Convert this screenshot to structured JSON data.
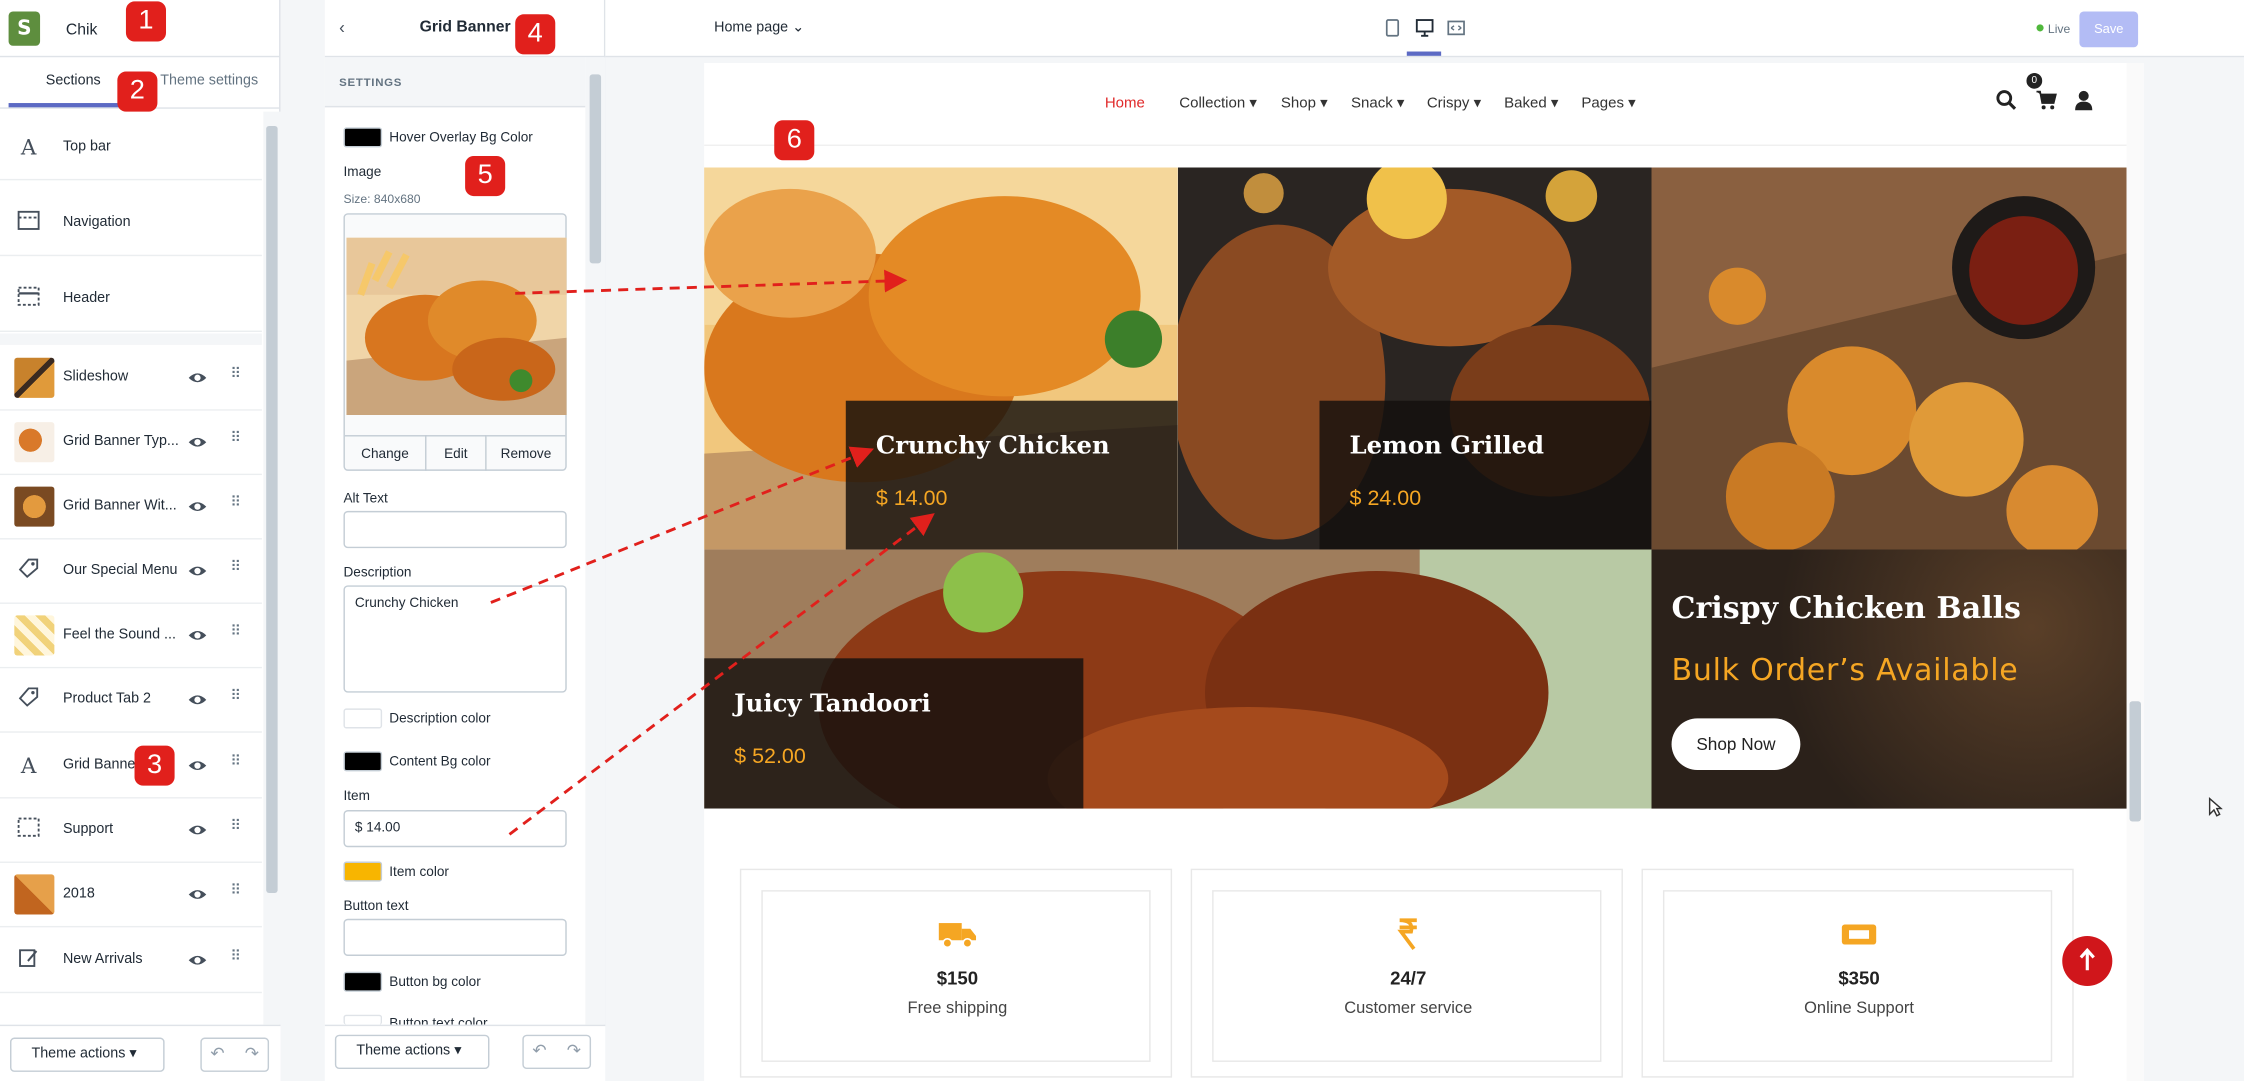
{
  "colors": {
    "accent": "#5c6ac4",
    "price": "#f5a623",
    "nav_active": "#e0292a",
    "scroll_top": "#d0161b",
    "annotation": "#e1201c",
    "live": "#50b83c"
  },
  "shop": {
    "name": "Chik"
  },
  "left_tabs": {
    "sections": "Sections",
    "theme_settings": "Theme settings"
  },
  "sections": [
    {
      "label": "Top bar",
      "icon": "text-icon"
    },
    {
      "label": "Navigation",
      "icon": "navigation-icon"
    },
    {
      "label": "Header",
      "icon": "header-icon"
    },
    {
      "label": "Slideshow",
      "icon": "image-thumb"
    },
    {
      "label": "Grid Banner Typ...",
      "icon": "image-thumb"
    },
    {
      "label": "Grid Banner Wit...",
      "icon": "image-thumb"
    },
    {
      "label": "Our Special Menu",
      "icon": "tag-icon"
    },
    {
      "label": "Feel the Sound ...",
      "icon": "image-thumb"
    },
    {
      "label": "Product Tab 2",
      "icon": "tag-icon"
    },
    {
      "label": "Grid Banner",
      "icon": "text-icon"
    },
    {
      "label": "Support",
      "icon": "navigation-icon"
    },
    {
      "label": "2018",
      "icon": "image-thumb"
    },
    {
      "label": "New Arrivals",
      "icon": "edit-icon"
    }
  ],
  "footer": {
    "theme_actions": "Theme actions"
  },
  "settings": {
    "title": "Grid Banner",
    "header": "SETTINGS",
    "hover_overlay_label": "Hover Overlay Bg Color",
    "image_label": "Image",
    "image_size": "Size: 840x680",
    "change": "Change",
    "edit": "Edit",
    "remove": "Remove",
    "alt_text_label": "Alt Text",
    "alt_text_value": "",
    "description_label": "Description",
    "description_value": "Crunchy Chicken",
    "description_color_label": "Description color",
    "content_bg_label": "Content Bg color",
    "item_label": "Item",
    "item_value": "$ 14.00",
    "item_color_label": "Item color",
    "button_text_label": "Button text",
    "button_text_value": "",
    "button_bg_label": "Button bg color",
    "button_text_color_label": "Button text color",
    "hover_overlay_color": "#000000",
    "description_color": "#ffffff",
    "content_bg_color": "#000000",
    "item_color": "#f8b500",
    "button_bg_color": "#000000"
  },
  "toolbar": {
    "page": "Home page",
    "live": "Live",
    "save": "Save"
  },
  "nav": {
    "items": [
      "Home",
      "Collection",
      "Shop",
      "Snack",
      "Crispy",
      "Baked",
      "Pages"
    ],
    "cart_count": "0"
  },
  "banners": [
    {
      "title": "Crunchy Chicken",
      "price": "$ 14.00"
    },
    {
      "title": "Lemon Grilled",
      "price": "$ 24.00"
    },
    {
      "title": "Juicy Tandoori",
      "price": "$ 52.00"
    }
  ],
  "promo": {
    "title": "Crispy Chicken Balls",
    "subtitle": "Bulk Order’s Available",
    "button": "Shop Now"
  },
  "features": [
    {
      "value": "$150",
      "label": "Free shipping",
      "icon": "truck-icon"
    },
    {
      "value": "24/7",
      "label": "Customer service",
      "icon": "rupee-icon"
    },
    {
      "value": "$350",
      "label": "Online Support",
      "icon": "ticket-icon"
    }
  ],
  "annotations": [
    "1",
    "2",
    "3",
    "4",
    "5",
    "6"
  ]
}
